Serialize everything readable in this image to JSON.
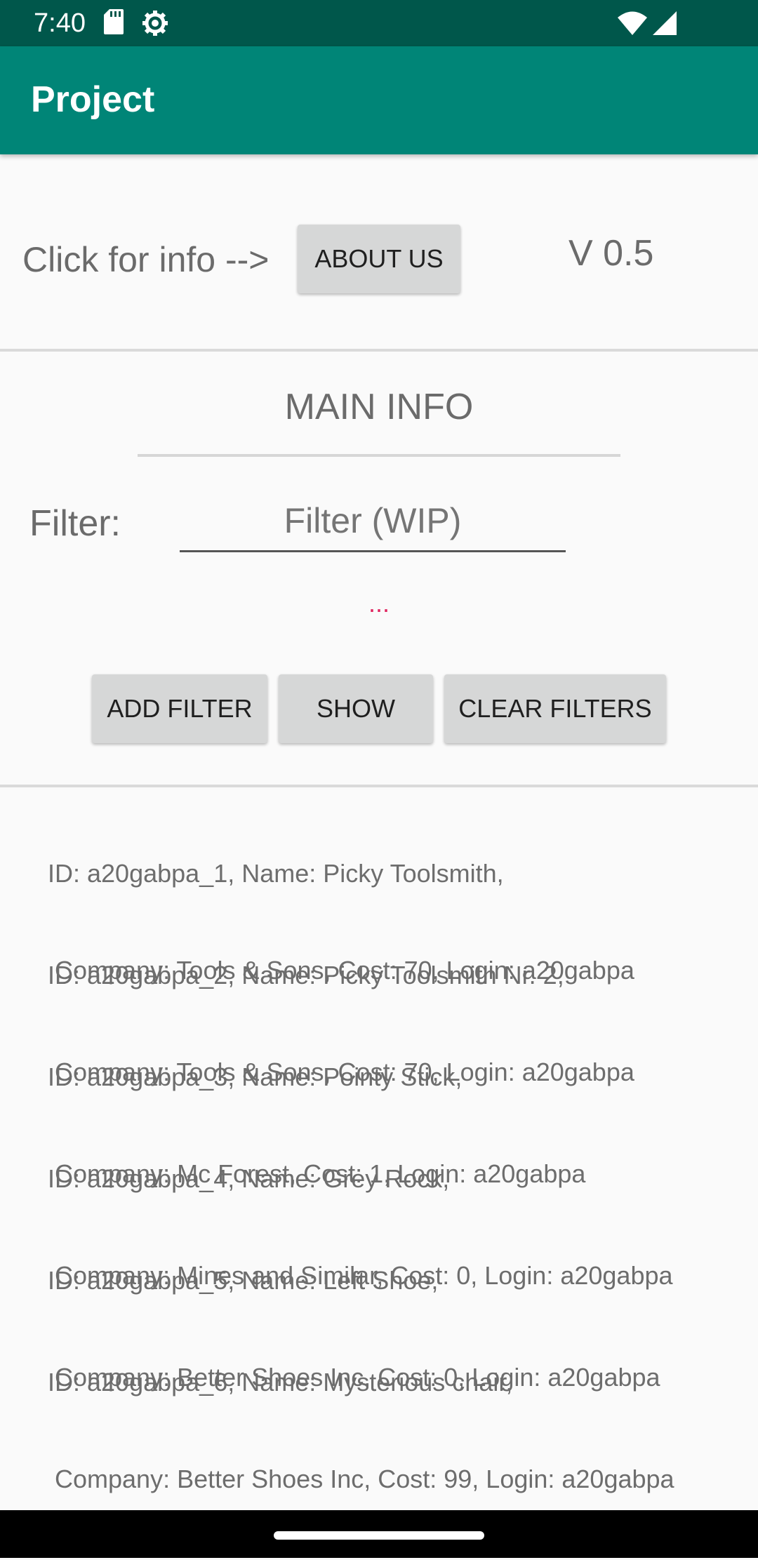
{
  "status_bar": {
    "time": "7:40",
    "icons": [
      "sd-card-icon",
      "settings-gear-icon",
      "wifi-icon",
      "signal-icon"
    ]
  },
  "app_bar": {
    "title": "Project",
    "color": "#008577",
    "status_color": "#00574b"
  },
  "header": {
    "info_text": "Click for info -->",
    "about_button": "ABOUT US",
    "version": "V 0.5"
  },
  "main": {
    "section_title": "MAIN INFO",
    "filter_label": "Filter:",
    "filter_placeholder": "Filter (WIP)",
    "filter_value": "",
    "active_filters": "...",
    "buttons": {
      "add_filter": "ADD FILTER",
      "show": "SHOW",
      "clear_filters": "CLEAR FILTERS"
    }
  },
  "list": {
    "items": [
      {
        "line1": "ID: a20gabpa_1, Name: Picky Toolsmith,",
        "line2": " Company: Tools & Sons, Cost: 70, Login: a20gabpa"
      },
      {
        "line1": "ID: a20gabpa_2, Name: Picky Toolsmith Nr. 2,",
        "line2": " Company: Tools & Sons, Cost: 70, Login: a20gabpa"
      },
      {
        "line1": "ID: a20gabpa_3, Name: Pointy Stick,",
        "line2": " Company: Mc Forest, Cost: 1, Login: a20gabpa"
      },
      {
        "line1": "ID: a20gabpa_4, Name: Grey Rock,",
        "line2": " Company: Mines and Similar, Cost: 0, Login: a20gabpa"
      },
      {
        "line1": "ID: a20gabpa_5, Name: Left Shoe,",
        "line2": " Company: Better Shoes Inc, Cost: 0, Login: a20gabpa"
      },
      {
        "line1": "ID: a20gabpa_6, Name: Mysterious chair,",
        "line2": " Company: Better Shoes Inc, Cost: 99, Login: a20gabpa"
      }
    ]
  }
}
